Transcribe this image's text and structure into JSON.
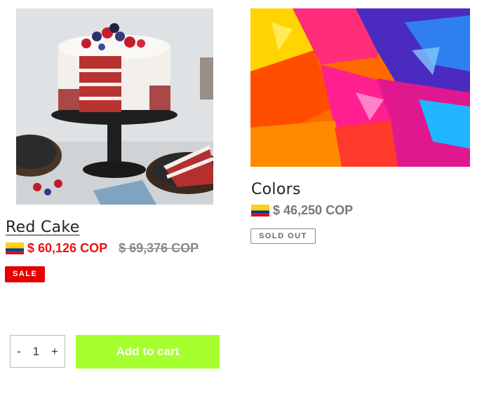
{
  "products": [
    {
      "title": "Red Cake",
      "price": "$ 60,126 COP",
      "compare_price": "$ 69,376 COP",
      "badge": "SALE",
      "image": "red-velvet-cake-photo",
      "flag": "colombia-flag-icon"
    },
    {
      "title": "Colors",
      "price": "$ 46,250 COP",
      "badge": "SOLD OUT",
      "image": "colorful-paint-abstract-photo",
      "flag": "colombia-flag-icon"
    }
  ],
  "cart": {
    "minus": "-",
    "quantity": "1",
    "plus": "+",
    "add_label": "Add to cart"
  },
  "colors": {
    "sale_price": "#ee1111",
    "sale_badge": "#e60000",
    "add_to_cart_bg": "#a6ff2e"
  }
}
